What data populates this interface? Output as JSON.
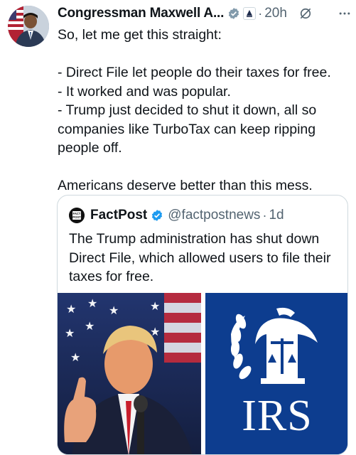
{
  "author": {
    "display_name": "Congressman Maxwell A...",
    "time": "20h",
    "dot": "·"
  },
  "tweet": {
    "lines": [
      "So, let me get this straight:",
      "",
      "- Direct File let people do their taxes for free.",
      "- It worked and was popular.",
      "- Trump just decided to shut it down, all so companies like TurboTax can keep ripping people off.",
      "",
      "Americans deserve better than this mess."
    ]
  },
  "quote": {
    "avatar_text": "FACT POST",
    "display_name": "FactPost",
    "handle": "@factpostnews",
    "time": "1d",
    "dot": "·",
    "text": "The Trump administration has shut down Direct File, which allowed users to file their taxes for free.",
    "media": {
      "left": "photo-of-trump-thumbs-up",
      "right": "irs-logo",
      "irs_label": "IRS"
    }
  },
  "colors": {
    "text": "#0f1419",
    "secondary": "#536471",
    "verified": "#1d9bf0",
    "border": "#cfd9de",
    "irs_blue": "#0d3d8f"
  },
  "icons": [
    "verified-badge-icon",
    "government-affiliation-icon",
    "grok-icon",
    "more-options-icon"
  ]
}
